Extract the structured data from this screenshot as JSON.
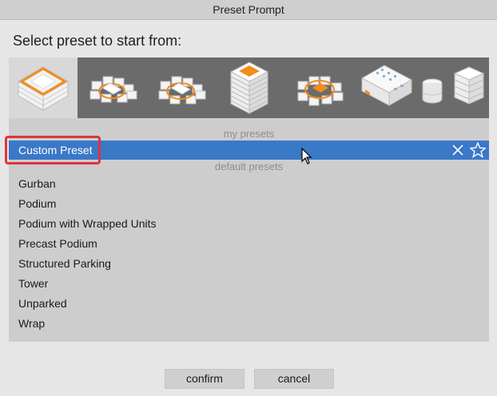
{
  "window": {
    "title": "Preset Prompt"
  },
  "prompt_text": "Select preset to start from:",
  "thumbnails": [
    {
      "name": "gurban-thumbnail",
      "selected": true
    },
    {
      "name": "podium-thumbnail",
      "selected": false
    },
    {
      "name": "podium-wrapped-thumbnail",
      "selected": false
    },
    {
      "name": "tower-thumbnail",
      "selected": false
    },
    {
      "name": "wrap-thumbnail",
      "selected": false
    },
    {
      "name": "precast-podium-thumbnail",
      "selected": false
    },
    {
      "name": "structured-parking-thumbnail",
      "selected": false
    }
  ],
  "my_presets": {
    "header": "my presets",
    "items": [
      {
        "label": "Custom Preset",
        "selected": true
      }
    ]
  },
  "default_presets": {
    "header": "default presets",
    "items": [
      "Gurban",
      "Podium",
      "Podium with Wrapped Units",
      "Precast Podium",
      "Structured Parking",
      "Tower",
      "Unparked",
      "Wrap"
    ]
  },
  "icons": {
    "delete": "close-icon",
    "favorite": "star-icon"
  },
  "buttons": {
    "confirm": "confirm",
    "cancel": "cancel"
  },
  "colors": {
    "selection": "#3a78c8",
    "highlight": "#e0343b",
    "accent": "#f28c1a"
  }
}
